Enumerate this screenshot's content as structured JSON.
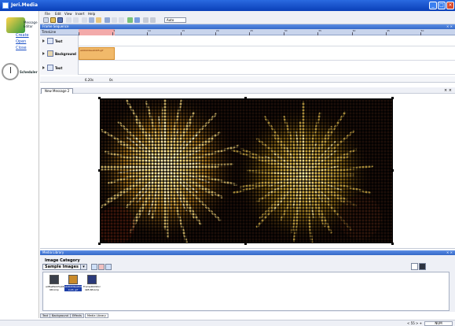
{
  "window": {
    "title": "Jeri.Media"
  },
  "leftnav": {
    "editor_label": "Message Editor",
    "links": [
      "Create",
      "Open",
      "Close"
    ],
    "scheduler_label": "Scheduler"
  },
  "menu": [
    "File",
    "Edit",
    "View",
    "Insert",
    "Help"
  ],
  "toolbar": {
    "zoom_value": "Auto"
  },
  "frame_sequence": {
    "header": "Frame Sequence",
    "ruler_label": "TimeLine",
    "tick_labels": [
      "",
      "5",
      "10",
      "15",
      "20",
      "25",
      "30",
      "35",
      "40",
      "45",
      "50"
    ],
    "tracks": [
      {
        "name": "Text",
        "clip": ""
      },
      {
        "name": "Background",
        "clip": "ab4b1b9ea6405.gif"
      },
      {
        "name": "Text",
        "clip": ""
      }
    ],
    "duration": "6.20s",
    "frame": "0s"
  },
  "message": {
    "tab_label": "New Message 2"
  },
  "media": {
    "header": "Media Library",
    "category_label": "Image Category",
    "category_value": "Sample Images",
    "items": [
      {
        "name": "a4fbe89d25a06",
        "size": "6B.bmp",
        "thumb_color": "#3a3f4a",
        "selected": false
      },
      {
        "name": "ab4b1b9ea6405",
        "size": "4.26 .gif",
        "thumb_color": "#c98a2a",
        "selected": true
      },
      {
        "name": "Frame46d90cc",
        "size": "4kB 6B.bmp",
        "thumb_color": "#2b3a7a",
        "selected": false
      }
    ]
  },
  "bottom_tabs": [
    "Text",
    "Background",
    "Effects",
    "Media Library"
  ],
  "status": {
    "zoom": "< 55 > +",
    "mode": "NUM"
  },
  "colors": {
    "accent": "#3468c8",
    "clip": "#f1b96a",
    "selected": "#1d3fa8"
  }
}
